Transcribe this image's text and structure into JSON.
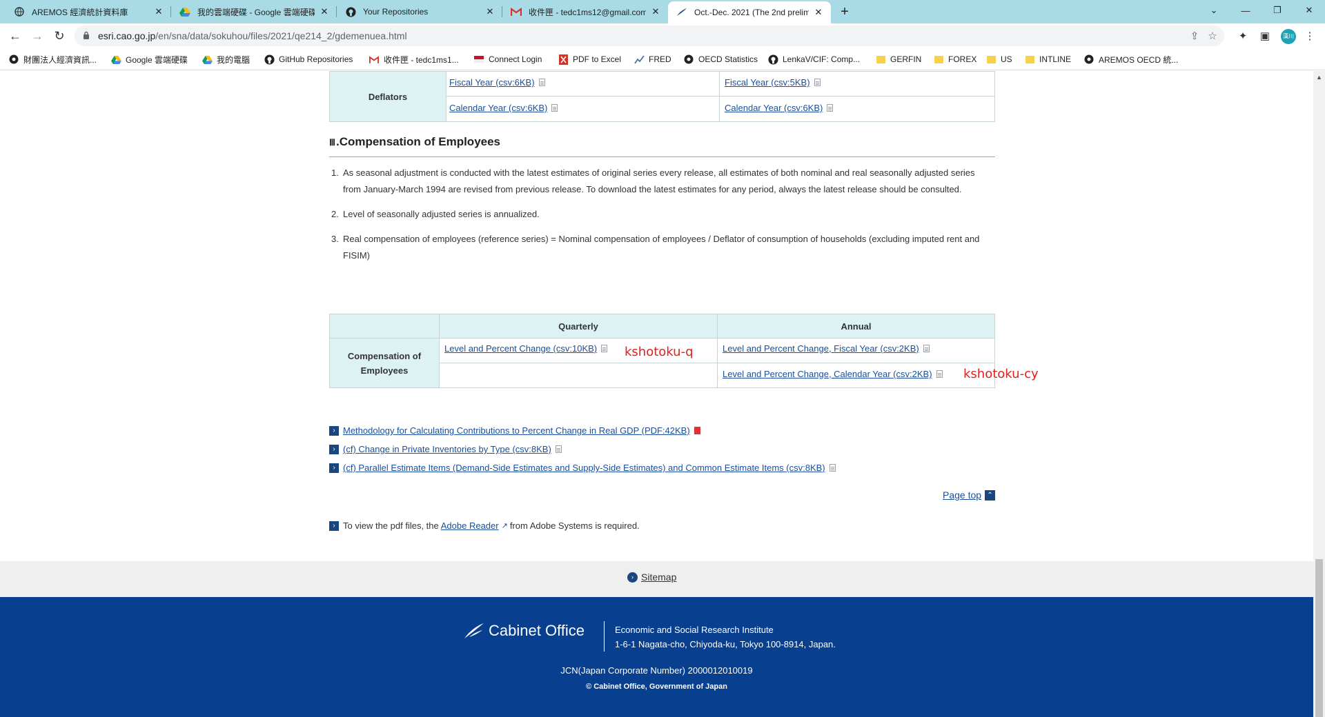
{
  "browser": {
    "tabs": [
      {
        "title": "AREMOS 經濟統計資料庫",
        "icon": "globe-icon",
        "active": false
      },
      {
        "title": "我的雲端硬碟 - Google 雲端硬碟",
        "icon": "google-drive-icon",
        "active": false
      },
      {
        "title": "Your Repositories",
        "icon": "github-icon",
        "active": false
      },
      {
        "title": "收件匣 - tedc1ms12@gmail.com",
        "icon": "gmail-icon",
        "active": false
      },
      {
        "title": "Oct.-Dec. 2021 (The 2nd prelim",
        "icon": "cabinet-office-icon",
        "active": true
      }
    ],
    "url_host": "esri.cao.go.jp",
    "url_path": "/en/sna/data/sokuhou/files/2021/qe214_2/gdemenuea.html",
    "profile_label": "漢川",
    "bookmarks": [
      {
        "label": "財團法人經濟資訊...",
        "icon": "globe-icon"
      },
      {
        "label": "Google 雲端硬碟",
        "icon": "google-drive-icon"
      },
      {
        "label": "我的電腦",
        "icon": "google-drive-icon"
      },
      {
        "label": "GitHub Repositories",
        "icon": "github-icon"
      },
      {
        "label": "收件匣 - tedc1ms1...",
        "icon": "gmail-icon"
      },
      {
        "label": "Connect Login",
        "icon": "flag-icon"
      },
      {
        "label": "PDF to Excel",
        "icon": "pdf-excel-icon"
      },
      {
        "label": "FRED",
        "icon": "chart-icon"
      },
      {
        "label": "OECD Statistics",
        "icon": "globe-icon"
      },
      {
        "label": "LenkaV/CIF: Comp...",
        "icon": "github-icon"
      },
      {
        "label": "GERFIN",
        "icon": "folder-icon"
      },
      {
        "label": "FOREX",
        "icon": "folder-icon"
      },
      {
        "label": "US",
        "icon": "folder-icon"
      },
      {
        "label": "INTLINE",
        "icon": "folder-icon"
      },
      {
        "label": "AREMOS OECD 統...",
        "icon": "globe-icon"
      }
    ]
  },
  "deflators": {
    "label": "Deflators",
    "rows": [
      {
        "quarterly": "Fiscal Year (csv:6KB)",
        "annual": "Fiscal Year (csv:5KB)"
      },
      {
        "quarterly": "Calendar Year (csv:6KB)",
        "annual": "Calendar Year (csv:6KB)"
      }
    ]
  },
  "section3": {
    "num": "Ⅲ",
    "title": ".Compensation of Employees",
    "notes": [
      {
        "n": "1.",
        "text": "As seasonal adjustment is conducted with the latest estimates of original series every release, all estimates of both nominal and real seasonally adjusted series from January-March 1994 are revised from previous release. To download the latest estimates for any period, always the latest release should be consulted."
      },
      {
        "n": "2.",
        "text": "Level of seasonally adjusted series is annualized."
      },
      {
        "n": "3.",
        "text": "Real compensation of employees (reference series) = Nominal compensation of employees / Deflator of consumption of households (excluding imputed rent and FISIM)"
      }
    ],
    "table": {
      "col_quarterly": "Quarterly",
      "col_annual": "Annual",
      "row_label": "Compensation of Employees",
      "quarterly_link": "Level and Percent Change (csv:10KB)",
      "annual_fy_link": "Level and Percent Change, Fiscal Year (csv:2KB)",
      "annual_cy_link": "Level and Percent Change, Calendar Year (csv:2KB)"
    },
    "annotations": {
      "quarterly": "kshotoku-q",
      "calendar": "kshotoku-cy"
    }
  },
  "related_links": [
    {
      "text": "Methodology for Calculating Contributions to Percent Change in Real GDP (PDF:42KB)",
      "type": "pdf"
    },
    {
      "text": "(cf) Change in Private Inventories by Type (csv:8KB)",
      "type": "csv"
    },
    {
      "text": "(cf) Parallel Estimate Items (Demand-Side Estimates and Supply-Side Estimates) and Common Estimate Items (csv:8KB)",
      "type": "csv"
    }
  ],
  "page_top": "Page top",
  "adobe_note": {
    "before": "To view the pdf files, the ",
    "link": "Adobe Reader",
    "after": " from Adobe Systems is required."
  },
  "sitemap": "Sitemap",
  "footer": {
    "logo": "Cabinet Office",
    "org_name": "Economic and Social Research Institute",
    "address": "1-6-1 Nagata-cho, Chiyoda-ku, Tokyo 100-8914, Japan.",
    "jcn": "JCN(Japan Corporate Number) 2000012010019",
    "copyright": "© Cabinet Office, Government of Japan"
  },
  "colors": {
    "tab_bar": "#a8dbe6",
    "link": "#1a4e9a",
    "table_header": "#ddf3f3",
    "footer_bg": "#083f8e",
    "annotation": "#e0211c"
  }
}
